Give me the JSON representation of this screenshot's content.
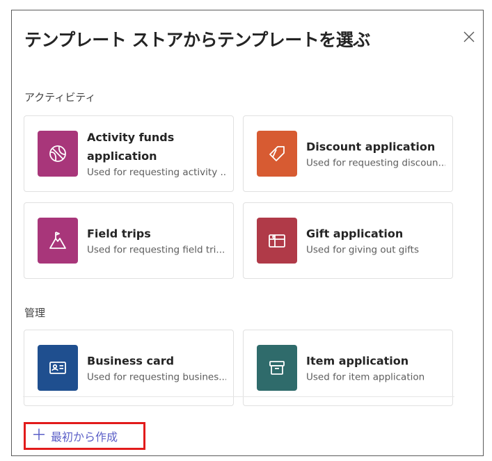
{
  "dialog": {
    "title": "テンプレート ストアからテンプレートを選ぶ",
    "close_icon": "close-icon"
  },
  "sections": [
    {
      "label": "アクティビティ",
      "cards": [
        {
          "title": "Activity funds application",
          "description": "Used for requesting activity ...",
          "icon": "basketball-icon",
          "color": "#a8367a"
        },
        {
          "title": "Discount application",
          "description": "Used for requesting discoun...",
          "icon": "tag-icon",
          "color": "#d75b32"
        },
        {
          "title": "Field trips",
          "description": "Used for requesting field tri...",
          "icon": "mountain-flag-icon",
          "color": "#a8367a"
        },
        {
          "title": "Gift application",
          "description": "Used for giving out gifts",
          "icon": "gift-icon",
          "color": "#b03a48"
        }
      ]
    },
    {
      "label": "管理",
      "cards": [
        {
          "title": "Business card",
          "description": "Used for requesting busines...",
          "icon": "contact-card-icon",
          "color": "#1f4f8f"
        },
        {
          "title": "Item application",
          "description": "Used for item application",
          "icon": "archive-box-icon",
          "color": "#2f6b6b"
        }
      ]
    }
  ],
  "footer": {
    "create_label": "最初から作成",
    "create_icon": "plus-icon",
    "accent_color": "#5b5fc7",
    "highlight_color": "#e21b1b"
  }
}
